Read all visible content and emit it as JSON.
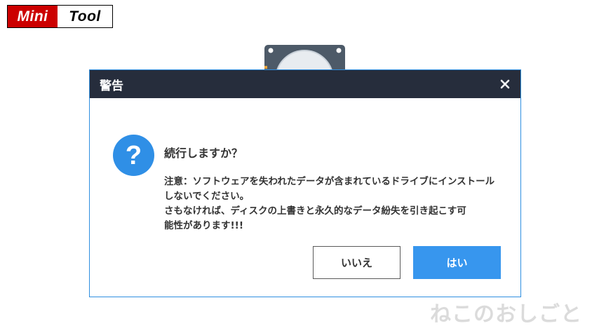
{
  "logo": {
    "part1": "Mini",
    "part2": "Tool"
  },
  "dialog": {
    "title": "警告",
    "close_icon": "close-icon",
    "icon": "question-icon",
    "heading": "続行しますか？",
    "message_lines": [
      "注意：ソフトウェアを失われたデータが含まれているドライブにインストール",
      "しないでください。",
      "さもなければ、ディスクの上書きと永久的なデータ紛失を引き起こす可",
      "能性があります!!!"
    ],
    "no_button": "いいえ",
    "yes_button": "はい"
  },
  "watermark": "ねこのおしごと",
  "colors": {
    "title_bar": "#262d3c",
    "accent": "#3796ee",
    "dialog_border": "#2f8fe0",
    "logo_red": "#cc0000"
  }
}
